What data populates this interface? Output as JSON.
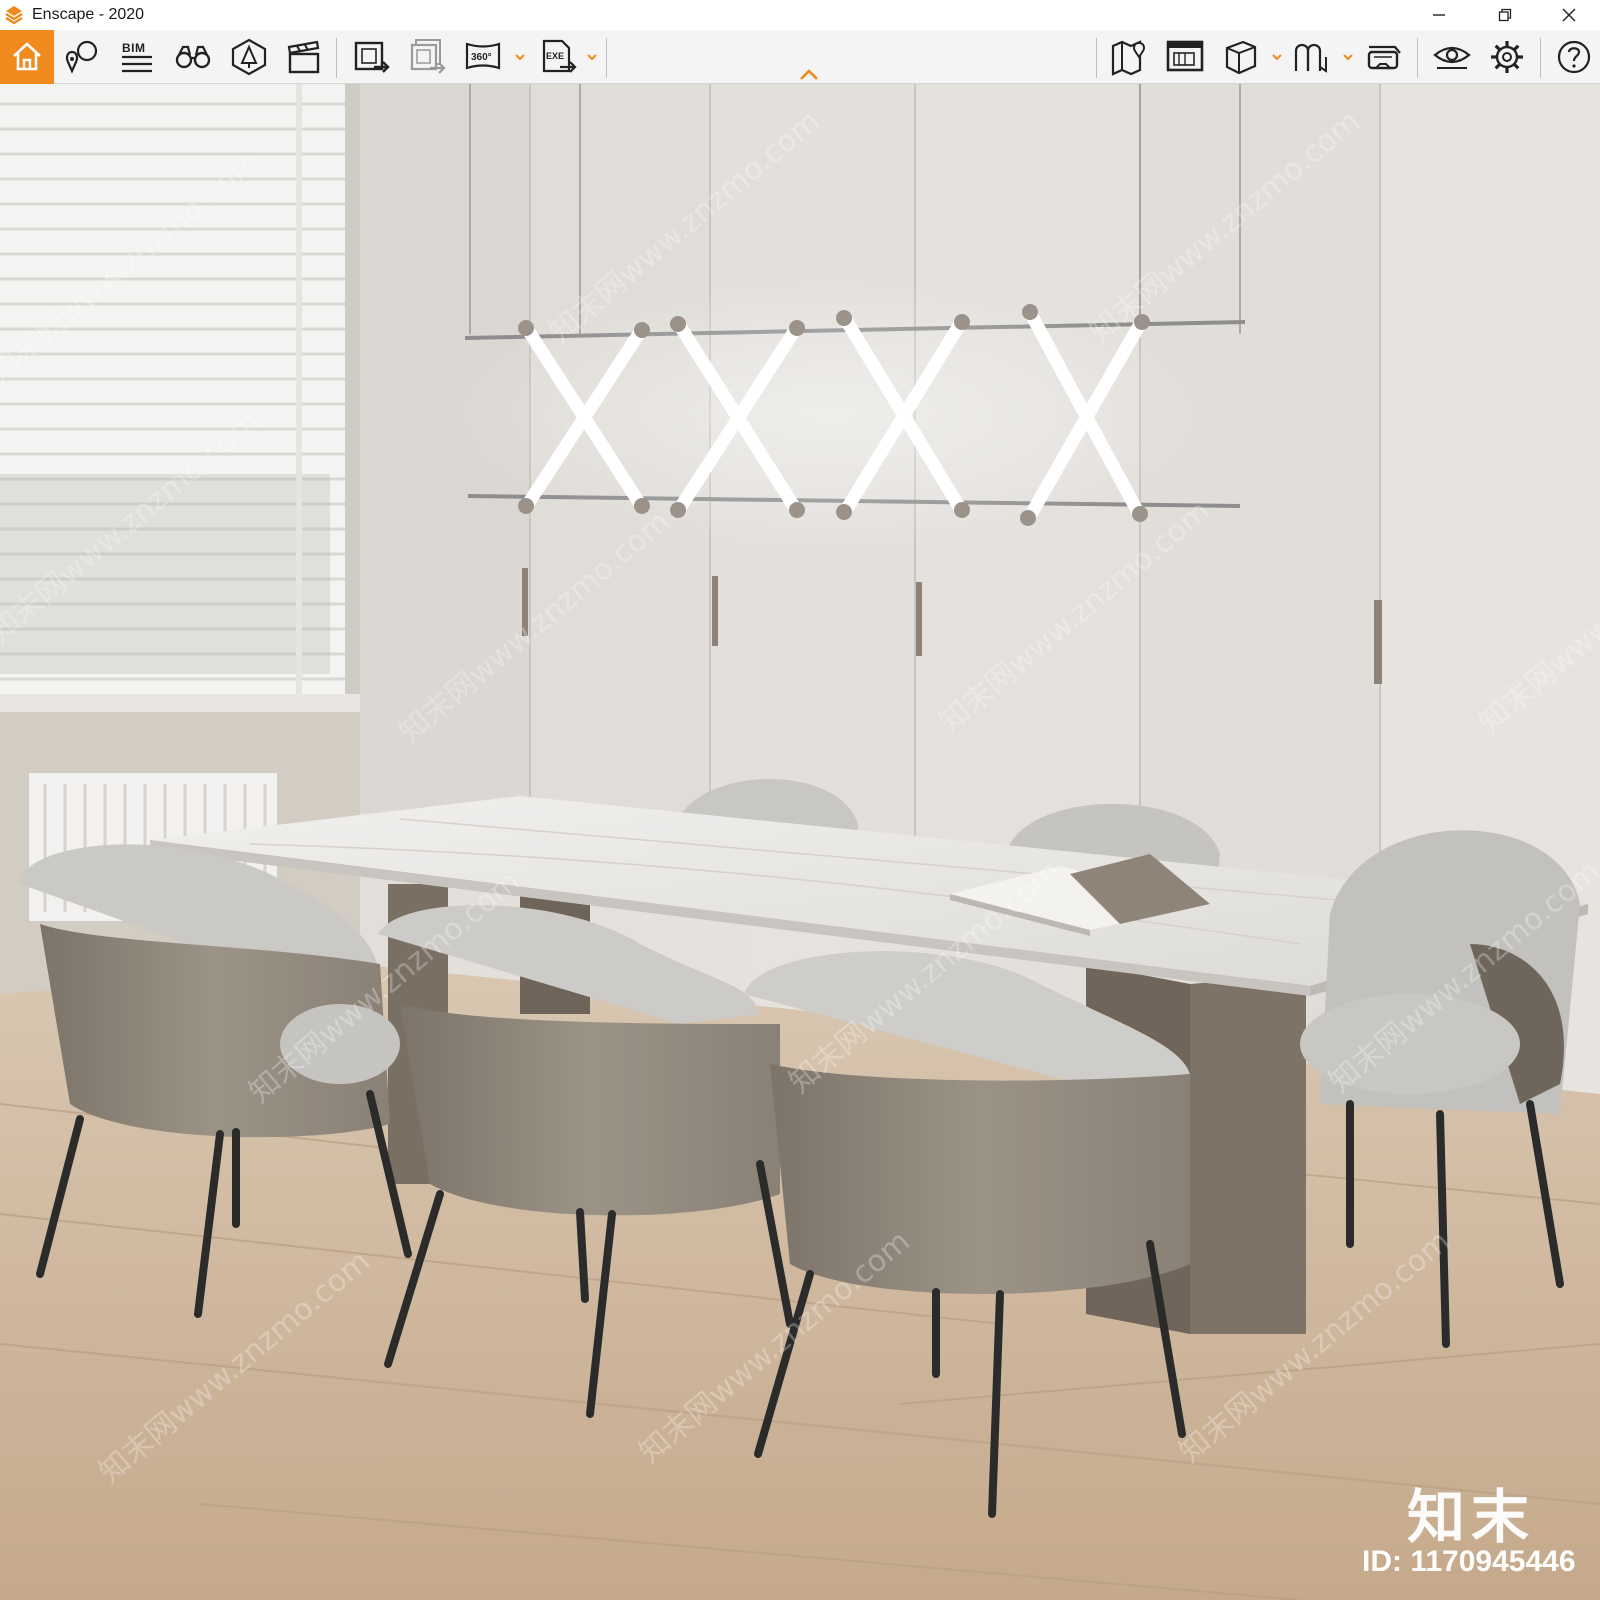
{
  "window": {
    "title": "Enscape - 2020",
    "icons": {
      "app": "enscape-logo-icon",
      "minimize": "minimize-icon",
      "restore": "restore-icon",
      "close": "close-icon"
    }
  },
  "toolbar": {
    "accent_color": "#f08a1c",
    "bim_label": "BIM",
    "buttons": [
      {
        "name": "home-button",
        "icon": "home-icon"
      },
      {
        "name": "views-button",
        "icon": "location-pin-icon"
      },
      {
        "name": "bim-button",
        "icon": "bim-list-icon"
      },
      {
        "name": "walk-mode-button",
        "icon": "binoculars-icon"
      },
      {
        "name": "assets-button",
        "icon": "tree-asset-icon"
      },
      {
        "name": "video-editor-button",
        "icon": "clapperboard-icon"
      },
      {
        "name": "render-image-button",
        "icon": "render-image-icon"
      },
      {
        "name": "batch-render-button",
        "icon": "batch-render-icon"
      },
      {
        "name": "panorama-button",
        "icon": "panorama-360-icon"
      },
      {
        "name": "export-exe-button",
        "icon": "export-exe-icon"
      },
      {
        "name": "map-button",
        "icon": "map-pin-icon"
      },
      {
        "name": "visual-settings-button",
        "icon": "screen-settings-icon"
      },
      {
        "name": "cube-view-button",
        "icon": "cube-icon"
      },
      {
        "name": "collaboration-button",
        "icon": "double-arch-icon"
      },
      {
        "name": "vr-headset-button",
        "icon": "vr-headset-icon"
      },
      {
        "name": "visibility-button",
        "icon": "eye-icon"
      },
      {
        "name": "settings-button",
        "icon": "gear-icon"
      },
      {
        "name": "help-button",
        "icon": "help-icon"
      }
    ],
    "panorama_badge": "360°",
    "exe_badge": "EXE"
  },
  "viewport": {
    "scene": "rendered dining room",
    "watermark_logo": "知末",
    "watermark_id": "ID: 1170945446",
    "watermark_repeat_text": "知末网www.znzmo.com"
  },
  "colors": {
    "wall": "#e4e1dd",
    "floor": "#cdb59b",
    "table_top": "#ecebe9",
    "chair_shell": "#8f867a",
    "chair_fabric": "#c9c7c3",
    "accent": "#f08a1c"
  }
}
